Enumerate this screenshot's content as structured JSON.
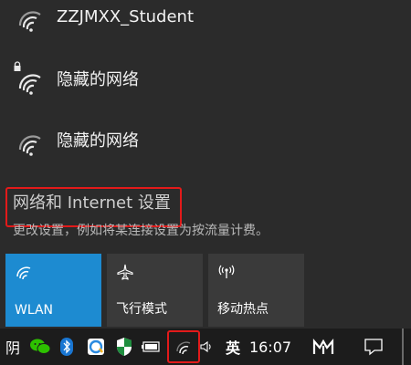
{
  "networks": [
    {
      "name": "ZZJMXX_Student",
      "secured": false
    },
    {
      "name": "隐藏的网络",
      "secured": true
    },
    {
      "name": "隐藏的网络",
      "secured": false
    }
  ],
  "settings": {
    "title": "网络和 Internet 设置",
    "description": "更改设置，例如将某连接设置为按流量计费。"
  },
  "quick_actions": [
    {
      "label": "WLAN",
      "icon": "wifi-icon",
      "active": true
    },
    {
      "label": "飞行模式",
      "icon": "airplane-icon",
      "active": false
    },
    {
      "label": "移动热点",
      "icon": "hotspot-icon",
      "active": false
    }
  ],
  "taskbar": {
    "weather": "阴",
    "ime": "英",
    "clock": "16:07"
  },
  "colors": {
    "accent": "#1d8bd1",
    "highlight": "#e21a1a",
    "flyout_bg": "#2b2b2b",
    "taskbar_bg": "#1c1c1c"
  }
}
